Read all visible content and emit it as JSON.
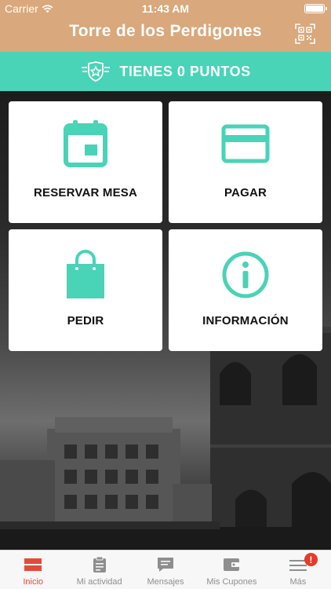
{
  "status": {
    "carrier": "Carrier",
    "time": "11:43 AM"
  },
  "nav": {
    "title": "Torre de los Perdigones",
    "qr_icon": "qr-code-icon"
  },
  "points": {
    "text": "TIENES 0 PUNTOS",
    "icon": "badge-star-icon"
  },
  "tiles": [
    {
      "label": "RESERVAR MESA",
      "icon": "calendar-icon"
    },
    {
      "label": "PAGAR",
      "icon": "credit-card-icon"
    },
    {
      "label": "PEDIR",
      "icon": "shopping-bag-icon"
    },
    {
      "label": "INFORMACIÓN",
      "icon": "info-icon"
    }
  ],
  "tabbar": [
    {
      "label": "Inicio",
      "icon": "home-icon",
      "active": true
    },
    {
      "label": "Mi actividad",
      "icon": "clipboard-icon"
    },
    {
      "label": "Mensajes",
      "icon": "chat-icon"
    },
    {
      "label": "Mis Cupones",
      "icon": "wallet-icon"
    },
    {
      "label": "Más",
      "icon": "menu-icon",
      "badge": "!"
    }
  ],
  "colors": {
    "header": "#d9a87c",
    "accent": "#49d3b7",
    "active_tab": "#e24b3a"
  }
}
